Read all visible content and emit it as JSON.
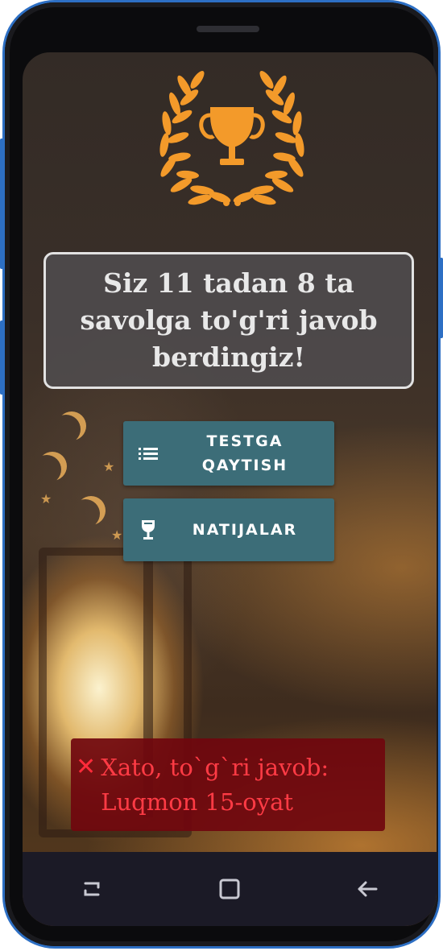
{
  "result": {
    "message": "Siz 11 tadan 8 ta savolga to'g'ri javob berdingiz!"
  },
  "buttons": {
    "back_to_test": "TESTGA QAYTISH",
    "results": "NATIJALAR"
  },
  "toast": {
    "text": "Xato, to`g`ri javob: Luqmon 15-oyat"
  },
  "colors": {
    "accent": "#f39a2a",
    "button": "#3c6d78",
    "error_bg": "#70060e",
    "error_text": "#ff3b45"
  },
  "icons": [
    "trophy-wreath-icon",
    "list-icon",
    "glass-icon",
    "close-icon",
    "recent-apps-icon",
    "home-icon",
    "back-icon"
  ]
}
